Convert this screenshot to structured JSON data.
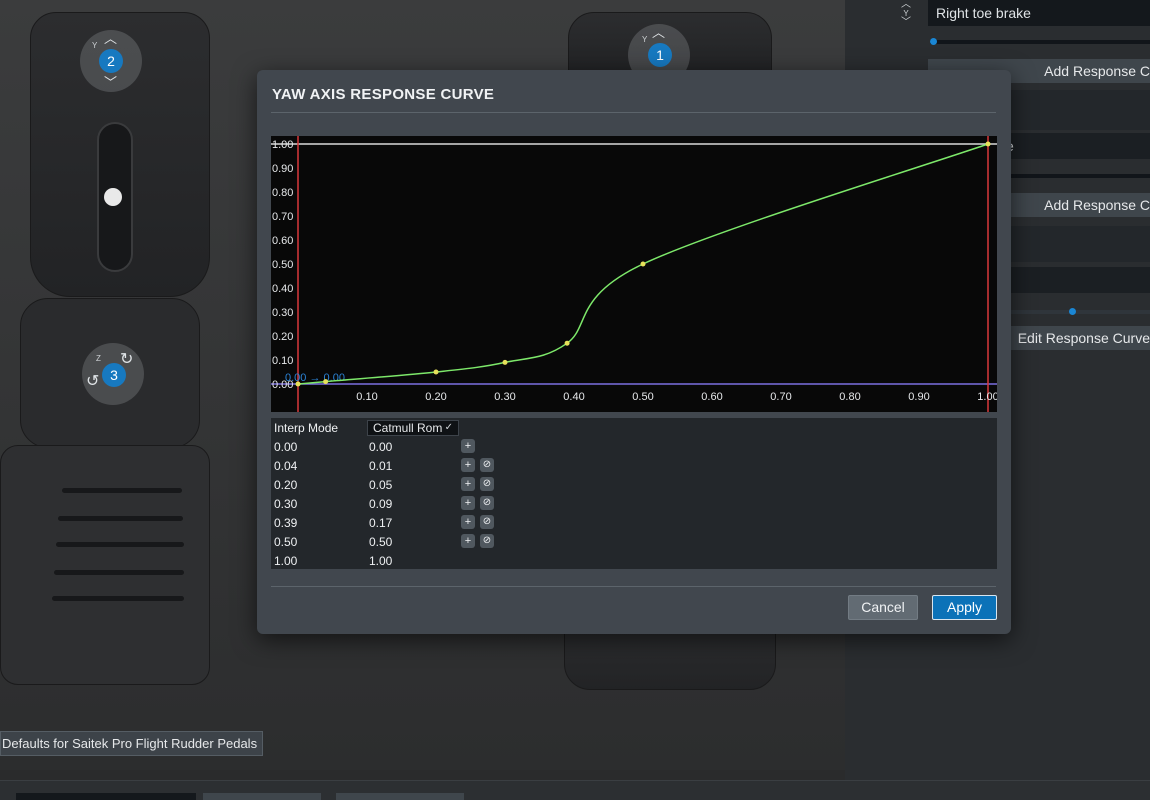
{
  "background": {
    "axis_badges": [
      {
        "number": "2",
        "axis_letter": "Y"
      },
      {
        "number": "1",
        "axis_letter": "Y"
      },
      {
        "number": "3",
        "axis_letter": "Z"
      }
    ],
    "defaults_button": "Defaults for Saitek Pro Flight Rudder Pedals"
  },
  "side_panel": {
    "right_toe_brake_label": "Right toe brake",
    "stepper_axis_letter": "Y",
    "add_response_curve_1": "Add Response C",
    "field_2_partial": "e",
    "add_response_curve_2": "Add Response C",
    "edit_response_curve": "Edit Response Curve"
  },
  "modal": {
    "title": "YAW AXIS RESPONSE CURVE",
    "cancel_label": "Cancel",
    "apply_label": "Apply",
    "table": {
      "header_label": "Interp Mode",
      "interp_mode": "Catmull Rom",
      "rows": [
        {
          "input": "0.00",
          "output": "0.00",
          "add": true,
          "remove": false
        },
        {
          "input": "0.04",
          "output": "0.01",
          "add": true,
          "remove": true
        },
        {
          "input": "0.20",
          "output": "0.05",
          "add": true,
          "remove": true
        },
        {
          "input": "0.30",
          "output": "0.09",
          "add": true,
          "remove": true
        },
        {
          "input": "0.39",
          "output": "0.17",
          "add": true,
          "remove": true
        },
        {
          "input": "0.50",
          "output": "0.50",
          "add": true,
          "remove": true
        },
        {
          "input": "1.00",
          "output": "1.00",
          "add": false,
          "remove": false
        }
      ]
    }
  },
  "chart_data": {
    "type": "line",
    "title": "",
    "xlabel": "",
    "ylabel": "",
    "xlim": [
      0,
      1
    ],
    "ylim": [
      0,
      1
    ],
    "x_ticks": [
      "0.10",
      "0.20",
      "0.30",
      "0.40",
      "0.50",
      "0.60",
      "0.70",
      "0.80",
      "0.90",
      "1.00"
    ],
    "y_ticks": [
      "0.00",
      "0.10",
      "0.20",
      "0.30",
      "0.40",
      "0.50",
      "0.60",
      "0.70",
      "0.80",
      "0.90",
      "1.00"
    ],
    "cursor_readout": "0.00 → 0.00",
    "series": [
      {
        "x": [
          0.0,
          0.04,
          0.2,
          0.3,
          0.39,
          0.5,
          1.0
        ],
        "y": [
          0.0,
          0.01,
          0.05,
          0.09,
          0.17,
          0.5,
          1.0
        ]
      }
    ],
    "colors": {
      "curve": "#7de86a",
      "points": "#e6e05a",
      "bound_lines": "#d8383a",
      "baseline": "#7b6fe0",
      "topline": "#d9d9d9",
      "readout": "#2b83d6"
    }
  }
}
